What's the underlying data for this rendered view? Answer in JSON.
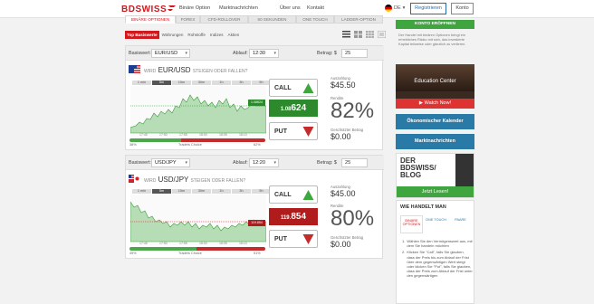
{
  "brand": {
    "logo_text": "BDSWISS",
    "brand_red": "#d0181f"
  },
  "nav": {
    "items": [
      "Binäre Option",
      "Marktnachrichten",
      "Über uns",
      "Kontakt"
    ],
    "language": "DE",
    "register": "Registrieren",
    "konto": "Konto"
  },
  "tabs": [
    "BINÄRE OPTIONEN",
    "FOREX",
    "CFD-ROLLOVER",
    "60 SEKUNDEN",
    "ONE TOUCH",
    "LADDER-OPTION"
  ],
  "subtabs": [
    "Top Basiswerte",
    "Währungen",
    "Rohstoffe",
    "Indizes",
    "Aktien"
  ],
  "labels": {
    "basiswert": "Basiswert:",
    "ablauf": "Ablauf:",
    "betrag": "Betrag: $",
    "wird_prefix": "WIRD",
    "wird_suffix": "STEIGEN ODER FALLEN?",
    "call": "CALL",
    "put": "PUT",
    "auszahlung": "Auszahlung",
    "rendite": "Rendite",
    "geschuetzter": "Geschützter Betrag",
    "traders": "Traders Choice"
  },
  "timeframes": [
    "1 min",
    "5m",
    "15m",
    "30m",
    "1h",
    "3h",
    "5h"
  ],
  "assets": [
    {
      "name": "EUR/USD",
      "expiry": "12:30",
      "amount": "25",
      "price_main": "1.08",
      "price_tail": "624",
      "price_color": "#2c8a2c",
      "tag_price": "1.08624",
      "payout": "$45.50",
      "return": "82%",
      "protected": "$0.00",
      "sent_left": "38%",
      "sent_right": "62%",
      "sent_green": 0.38,
      "times": [
        "17:45",
        "17:50",
        "17:55",
        "18:00",
        "18:05",
        "18:10",
        "18:15"
      ]
    },
    {
      "name": "USD/JPY",
      "expiry": "12:20",
      "amount": "25",
      "price_main": "119.",
      "price_tail": "854",
      "price_color": "#b01c1c",
      "tag_price": "119.854",
      "payout": "$45.00",
      "return": "80%",
      "protected": "$0.00",
      "sent_left": "49%",
      "sent_right": "51%",
      "sent_green": 0.49,
      "times": [
        "17:45",
        "17:50",
        "17:55",
        "18:00",
        "18:05",
        "18:10",
        "18:15"
      ]
    }
  ],
  "sidebar": {
    "konto_button": "KONTO ERÖFFNEN",
    "blurb": "Der Handel mit binären Optionen bringt ein erhebliches Risiko mit sich, das investierte Kapital teilweise oder gänzlich zu verlieren.",
    "edu_title": "Education Center",
    "watch": "Watch Now!",
    "kalender": "Ökonomischer Kalender",
    "markt": "Marktnachrichten",
    "blog_lines": [
      "DER",
      "BDSWISS/",
      "BLOG"
    ],
    "jetzt": "Jetzt Lesen!",
    "wie_title": "WIE HANDELT MAN",
    "wie_tabs": [
      "BINÄRE OPTIONEN",
      "ONE TOUCH",
      "PAARE"
    ],
    "steps": [
      "Wählen Sie den Vermögenswert aus, mit dem Sie handeln möchten",
      "Klicken Sie \"Call\", falls Sie glauben, dass der Preis bis zum Ablauf der Frist über dem gegenwärtigen Wert steigt oder klicken Sie \"Put\", falls Sie glauben, dass der Preis zum Ablauf der Frist unter den gegenwärtigen"
    ]
  }
}
